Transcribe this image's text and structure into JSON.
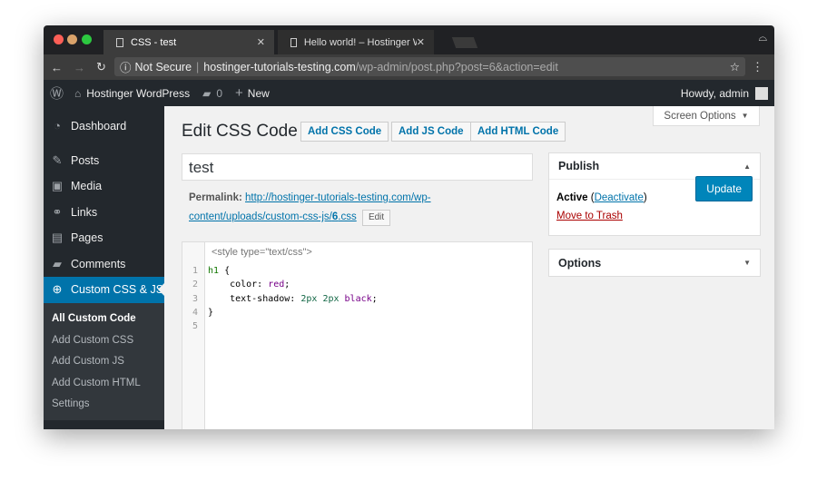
{
  "browser": {
    "tabs": [
      {
        "label": "CSS - test",
        "active": true
      },
      {
        "label": "Hello world! – Hostinger WordP",
        "active": false
      }
    ],
    "security": "Not Secure",
    "url_host": "hostinger-tutorials-testing.com",
    "url_path": "/wp-admin/post.php?post=6&action=edit"
  },
  "adminbar": {
    "site": "Hostinger WordPress",
    "comments": "0",
    "new": "New",
    "howdy": "Howdy, admin"
  },
  "sidebar": {
    "items": [
      {
        "label": "Dashboard",
        "icon": "dashboard-icon"
      },
      {
        "label": "Posts",
        "icon": "pin-icon"
      },
      {
        "label": "Media",
        "icon": "media-icon"
      },
      {
        "label": "Links",
        "icon": "link-icon"
      },
      {
        "label": "Pages",
        "icon": "pages-icon"
      },
      {
        "label": "Comments",
        "icon": "comment-icon"
      },
      {
        "label": "Custom CSS & JS",
        "icon": "plus-circle-icon"
      }
    ],
    "submenu": [
      "All Custom Code",
      "Add Custom CSS",
      "Add Custom JS",
      "Add Custom HTML",
      "Settings"
    ]
  },
  "main": {
    "title": "Edit CSS Code",
    "add_css": "Add CSS Code",
    "add_js": "Add JS Code",
    "add_html": "Add HTML Code",
    "screen_options": "Screen Options",
    "post_title": "test",
    "permalink_label": "Permalink:",
    "permalink_1": "http://hostinger-tutorials-testing.com/wp-",
    "permalink_2": "content/uploads/custom-css-js/",
    "permalink_3": "6",
    "permalink_4": ".css",
    "edit": "Edit",
    "style_tag": "<style type=\"text/css\">",
    "code": {
      "l1a": "h1",
      "l1b": " {",
      "l2a": "    color: ",
      "l2b": "red",
      "l2c": ";",
      "l3a": "    text-shadow: ",
      "l3b": "2px 2px ",
      "l3c": "black",
      "l3d": ";",
      "l4": "}"
    },
    "line_numbers": [
      "1",
      "2",
      "3",
      "4",
      "5"
    ]
  },
  "publish": {
    "title": "Publish",
    "status": "Active",
    "deactivate": "Deactivate",
    "trash": "Move to Trash",
    "update": "Update"
  },
  "options": {
    "title": "Options"
  }
}
